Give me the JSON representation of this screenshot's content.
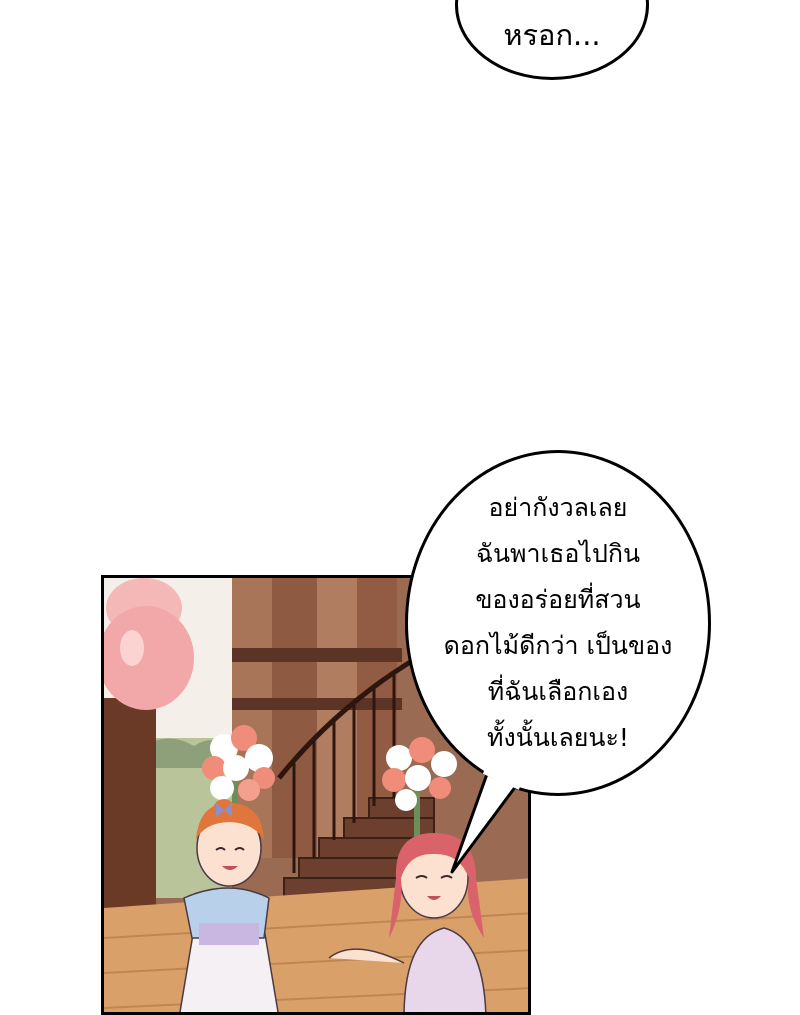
{
  "bubbles": {
    "top": {
      "text": "หรอก..."
    },
    "main": {
      "lines": [
        "อย่ากังวลเลย",
        "ฉันพาเธอไปกิน",
        "ของอร่อยที่สวน",
        "ดอกไม้ดีกว่า เป็นของ",
        "ที่ฉันเลือกเอง",
        "ทั้งนั้นเลยนะ!"
      ]
    }
  },
  "colors": {
    "bubble_fill": "#ffffff",
    "outline": "#000000",
    "wood": "#8a5a46",
    "floor": "#d9a06a",
    "balloon": "#f2a7a8",
    "hair_left": "#e0763c",
    "hair_right": "#d9626b"
  }
}
